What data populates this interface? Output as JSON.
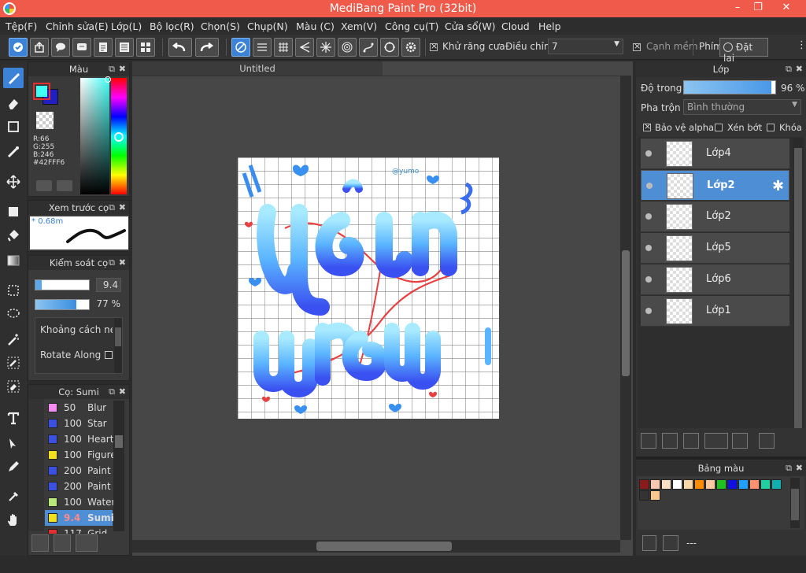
{
  "app": {
    "title": "MediBang Paint Pro (32bit)"
  },
  "menu": [
    "Tệp(F)",
    "Chỉnh sửa(E)",
    "Lớp(L)",
    "Bộ lọc(R)",
    "Chọn(S)",
    "Chụp(N)",
    "Màu (C)",
    "Xem(V)",
    "Công cụ(T)",
    "Cửa sổ(W)",
    "Cloud",
    "Help"
  ],
  "toolbar": {
    "antialias_label": "Khử răng cưa",
    "adjust_label": "Điều chỉnh",
    "adjust_value": "7",
    "smooth_label": "Cạnh mềm",
    "key_label": "Phím",
    "reset_label": "Đặt lại"
  },
  "color_panel": {
    "title": "Màu",
    "r": "R:66",
    "g": "G:255",
    "b": "B:246",
    "hex": "#42FFF6",
    "current_color": "#42fff6"
  },
  "brush_preview": {
    "title": "Xem trước cọ",
    "size": "0.68m"
  },
  "brush_control": {
    "title": "Kiểm soát cọ",
    "size_value": "9.4",
    "opacity_value": "77 %",
    "size_fraction": 0.12,
    "opacity_fraction": 0.77,
    "spacing_label": "Khoảng cách né",
    "rotate_label": "Rotate Along"
  },
  "brush_list": {
    "title": "Cọ: Sumi",
    "items": [
      {
        "size": "50",
        "name": "Blur",
        "color": "#f58cf0"
      },
      {
        "size": "100",
        "name": "Star",
        "color": "#3a50e0"
      },
      {
        "size": "100",
        "name": "Heart",
        "color": "#3a50e0"
      },
      {
        "size": "100",
        "name": "Figure",
        "color": "#f2e020"
      },
      {
        "size": "200",
        "name": "Paint",
        "color": "#3a50e0"
      },
      {
        "size": "200",
        "name": "Paint",
        "color": "#3a50e0"
      },
      {
        "size": "100",
        "name": "Water",
        "color": "#b8e87a"
      },
      {
        "size": "9.4",
        "name": "Sumi",
        "color": "#f2e020"
      },
      {
        "size": "117",
        "name": "Grid",
        "color": "#e03030"
      }
    ]
  },
  "document": {
    "tab": "Untitled"
  },
  "layer_panel": {
    "title": "Lớp",
    "opacity_label": "Độ trong",
    "opacity_value": "96 %",
    "opacity_fraction": 0.96,
    "blend_label": "Pha trộn",
    "blend_value": "Bình thường",
    "protect_alpha": "Bảo vệ alpha",
    "clip": "Xén bớt",
    "lock": "Khóa",
    "layers": [
      {
        "name": "Lớp4",
        "selected": false
      },
      {
        "name": "Lớp2",
        "selected": true
      },
      {
        "name": "Lớp2",
        "selected": false
      },
      {
        "name": "Lớp5",
        "selected": false
      },
      {
        "name": "Lớp6",
        "selected": false
      },
      {
        "name": "Lớp1",
        "selected": false
      }
    ]
  },
  "palette_panel": {
    "title": "Bảng màu",
    "status": "---",
    "colors": [
      "#8b1a1a",
      "#f8c8b0",
      "#fbe0c8",
      "#ffffff",
      "#f8d8a8",
      "#ff8c00",
      "#ffc8a0",
      "#20c020",
      "#1010e0",
      "#20a0ff",
      "#ff9070",
      "#20d0a0",
      "#10b0b0",
      "#333333",
      "#f8c890"
    ]
  }
}
